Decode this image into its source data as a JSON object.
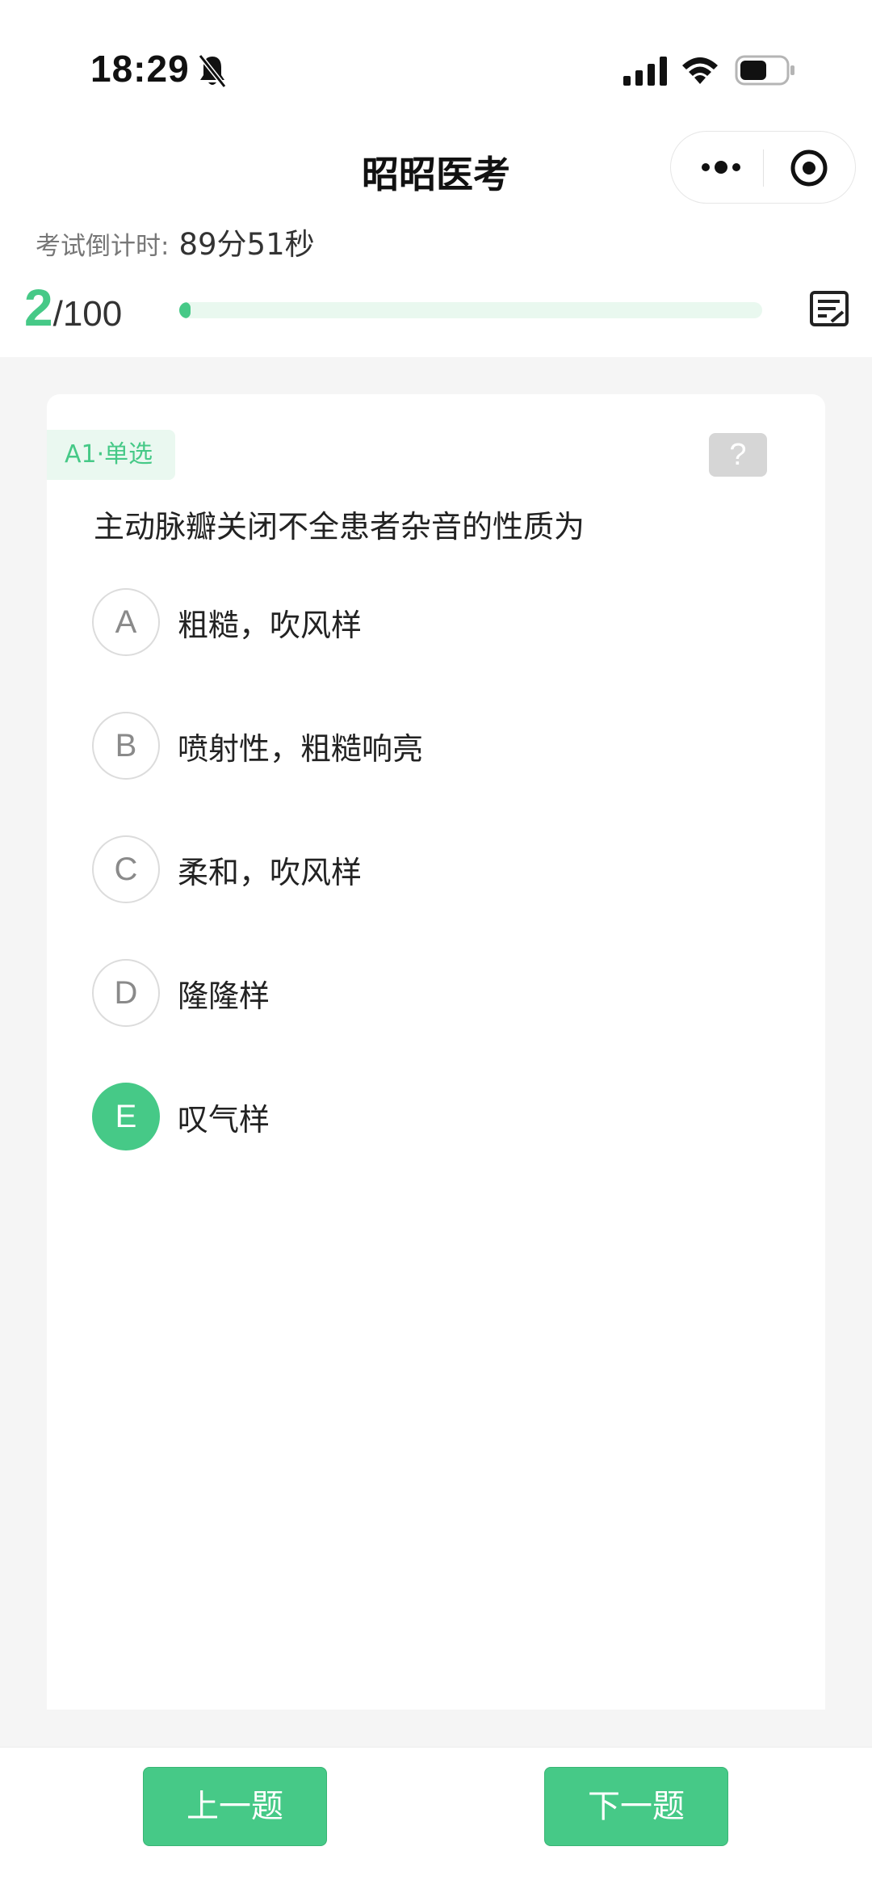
{
  "status_bar": {
    "time": "18:29"
  },
  "nav": {
    "title": "昭昭医考"
  },
  "countdown": {
    "label": "考试倒计时:",
    "value": "89分51秒"
  },
  "progress": {
    "current": "2",
    "total": "/100",
    "fraction": 0.02
  },
  "question": {
    "type_label": "A1·单选",
    "help_label": "?",
    "text": "主动脉瓣关闭不全患者杂音的性质为",
    "options": [
      {
        "letter": "A",
        "text": "粗糙，吹风样"
      },
      {
        "letter": "B",
        "text": "喷射性，粗糙响亮"
      },
      {
        "letter": "C",
        "text": "柔和，吹风样"
      },
      {
        "letter": "D",
        "text": "隆隆样"
      },
      {
        "letter": "E",
        "text": "叹气样"
      }
    ],
    "selected": "E"
  },
  "footer": {
    "prev_label": "上一题",
    "next_label": "下一题"
  },
  "colors": {
    "accent": "#46c987",
    "accent_light": "#eaf8f0",
    "help_gray": "#d6d6d6"
  },
  "icons": {
    "status": [
      "bell-off-icon",
      "signal-icon",
      "wifi-icon",
      "battery-icon"
    ],
    "capsule": [
      "more-icon",
      "close-target-icon"
    ],
    "answer_sheet": "answer-sheet-icon"
  }
}
